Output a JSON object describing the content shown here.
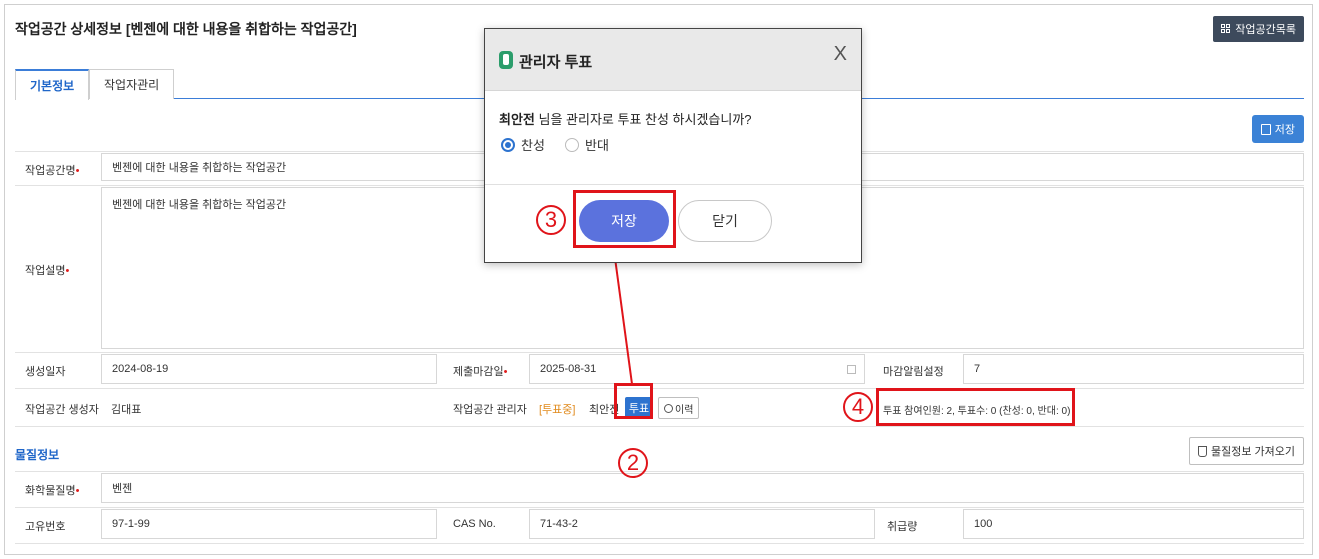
{
  "page": {
    "title": "작업공간 상세정보 [벤젠에 대한 내용을 취합하는 작업공간]",
    "list_button": "작업공간목록",
    "tabs": [
      {
        "label": "기본정보"
      },
      {
        "label": "작업자관리"
      }
    ],
    "save_button": "저장"
  },
  "form": {
    "workspace_name_label": "작업공간명",
    "workspace_name": "벤젠에 대한 내용을 취합하는 작업공간",
    "description_label": "작업설명",
    "description": "벤젠에 대한 내용을 취합하는 작업공간",
    "created_label": "생성일자",
    "created": "2024-08-19",
    "deadline_label": "제출마감일",
    "deadline": "2025-08-31",
    "alarm_label": "마감알림설정",
    "alarm": "7",
    "creator_label": "작업공간 생성자",
    "creator": "김대표",
    "manager_label": "작업공간 관리자",
    "manager_status": "[투표중]",
    "manager_name": "최안전",
    "vote_button": "투표",
    "history_button": "이력",
    "vote_summary": "투표 참여인원: 2, 투표수: 0 (찬성: 0, 반대: 0)"
  },
  "substance": {
    "section_title": "물질정보",
    "fetch_button": "물질정보 가져오기",
    "chem_name_label": "화학물질명",
    "chem_name": "벤젠",
    "id_label": "고유번호",
    "id": "97-1-99",
    "cas_label": "CAS No.",
    "cas": "71-43-2",
    "amount_label": "취급량",
    "amount": "100"
  },
  "dialog": {
    "title": "관리자 투표",
    "close": "X",
    "question_name": "최안전",
    "question_rest": " 님을 관리자로 투표 찬성 하시겠습니까?",
    "option_yes": "찬성",
    "option_no": "반대",
    "save": "저장",
    "cancel": "닫기"
  },
  "annotations": {
    "step2": "2",
    "step3": "3",
    "step4": "4"
  },
  "colors": {
    "primary": "#2d73cf",
    "highlight": "#e0141a",
    "dialog_save": "#5b72dd"
  }
}
